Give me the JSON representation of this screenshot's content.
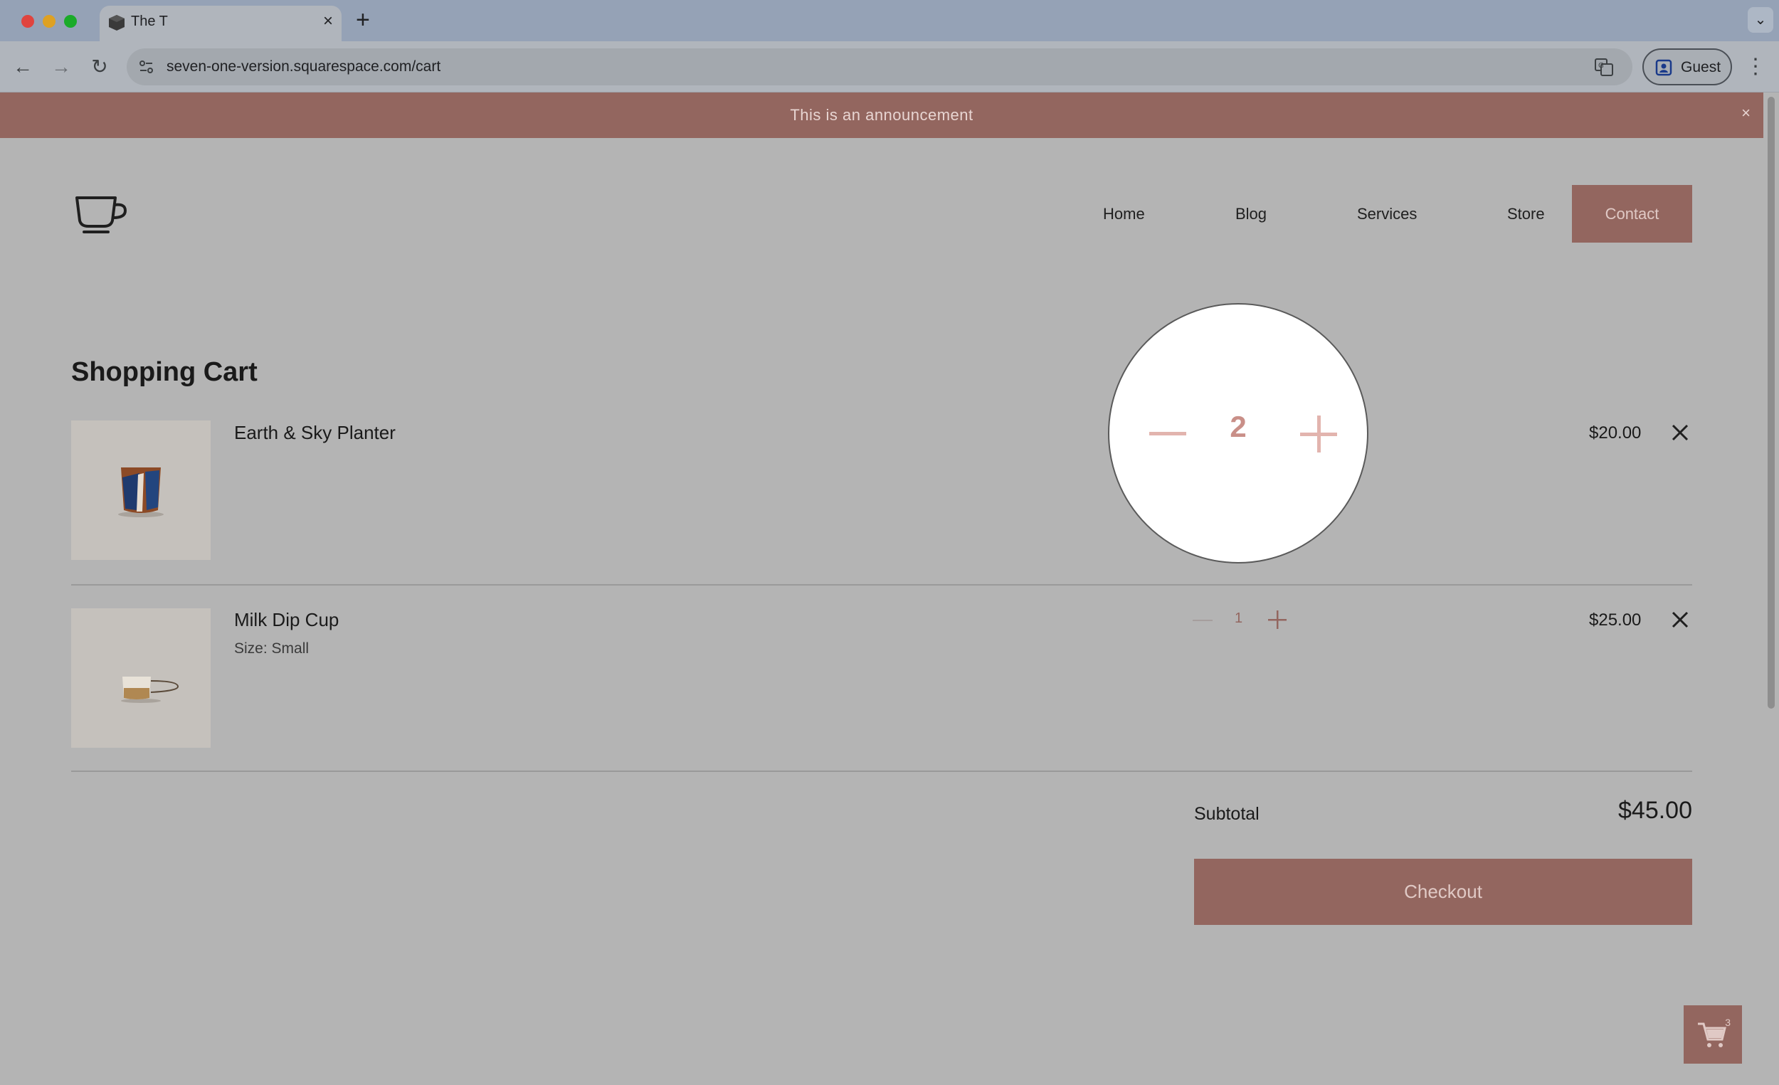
{
  "browser": {
    "tab_title": "The T",
    "url": "seven-one-version.squarespace.com/cart",
    "profile_label": "Guest"
  },
  "announcement": {
    "text": "This is an announcement",
    "close": "×"
  },
  "nav": {
    "items": [
      {
        "label": "Home"
      },
      {
        "label": "Blog"
      },
      {
        "label": "Services"
      },
      {
        "label": "Store"
      }
    ],
    "cta": "Contact"
  },
  "cart": {
    "title": "Shopping Cart",
    "items": [
      {
        "name": "Earth & Sky Planter",
        "variant": "",
        "quantity": "2",
        "price": "$20.00"
      },
      {
        "name": "Milk Dip Cup",
        "variant": "Size: Small",
        "quantity": "1",
        "price": "$25.00"
      }
    ],
    "subtotal_label": "Subtotal",
    "subtotal_value": "$45.00",
    "checkout_label": "Checkout",
    "cart_count": "3"
  },
  "colors": {
    "accent": "#93665f",
    "overlay": "#b4b4b4"
  }
}
